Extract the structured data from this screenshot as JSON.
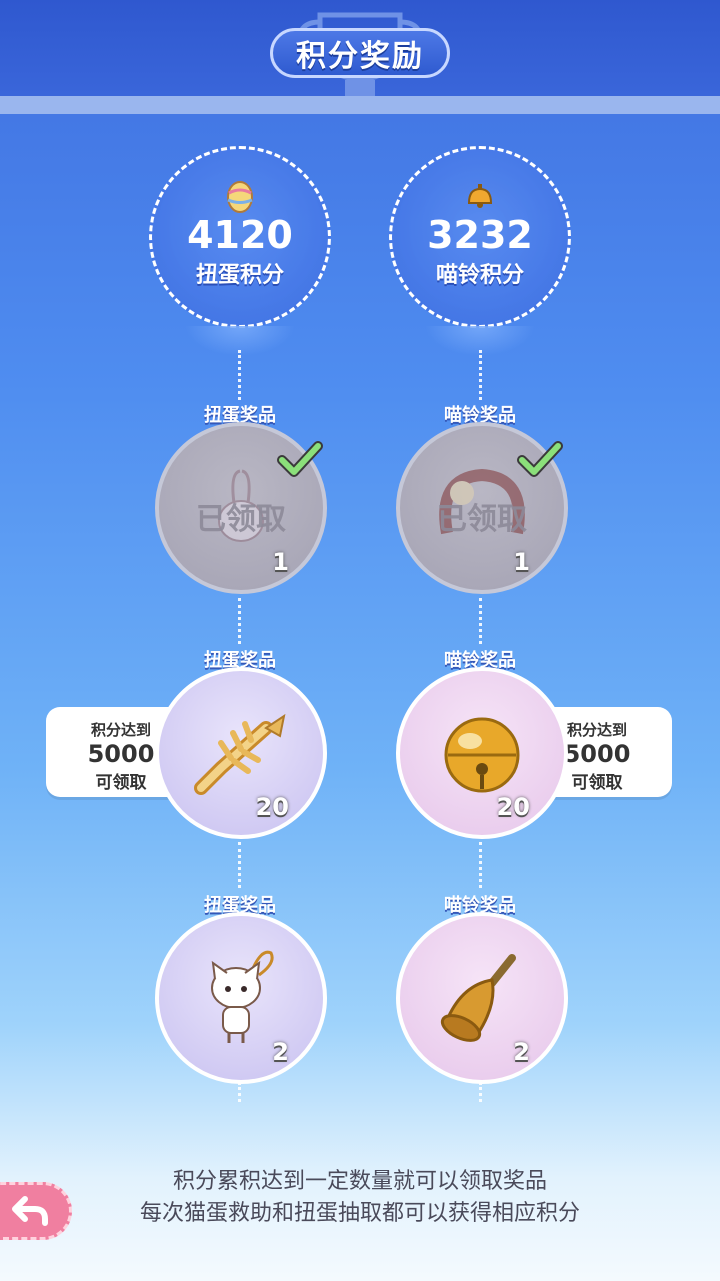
{
  "header": {
    "title": "积分奖励"
  },
  "scores": {
    "egg": {
      "value": "4120",
      "label": "扭蛋积分",
      "icon": "easter-egg-icon"
    },
    "bell": {
      "value": "3232",
      "label": "喵铃积分",
      "icon": "bell-icon"
    }
  },
  "egg_rewards": [
    {
      "title": "扭蛋奖品",
      "num": "#5",
      "count": "1",
      "state": "claimed",
      "claimed_label": "已领取",
      "item": "rabbit-charm-icon"
    },
    {
      "title": "扭蛋奖品",
      "num": "#6",
      "count": "20",
      "state": "locked",
      "item": "fishbone-icon"
    },
    {
      "title": "扭蛋奖品",
      "num": "#7",
      "count": "2",
      "state": "locked",
      "item": "cat-doll-icon"
    }
  ],
  "bell_rewards": [
    {
      "title": "喵铃奖品",
      "num": "#5",
      "count": "1",
      "state": "claimed",
      "claimed_label": "已领取",
      "item": "headband-icon"
    },
    {
      "title": "喵铃奖品",
      "num": "#6",
      "count": "20",
      "state": "locked",
      "item": "golden-bell-icon"
    },
    {
      "title": "喵铃奖品",
      "num": "#7",
      "count": "2",
      "state": "locked",
      "item": "hand-bell-icon"
    }
  ],
  "egg_requirement": {
    "line1": "积分达到",
    "line2": "5000",
    "line3": "可领取"
  },
  "bell_requirement": {
    "line1": "积分达到",
    "line2": "5000",
    "line3": "可领取"
  },
  "footer": {
    "line1": "积分累积达到一定数量就可以领取奖品",
    "line2": "每次猫蛋救助和扭蛋抽取都可以获得相应积分"
  },
  "colors": {
    "accent": "#3a66da",
    "back_button": "#f07fa0"
  }
}
